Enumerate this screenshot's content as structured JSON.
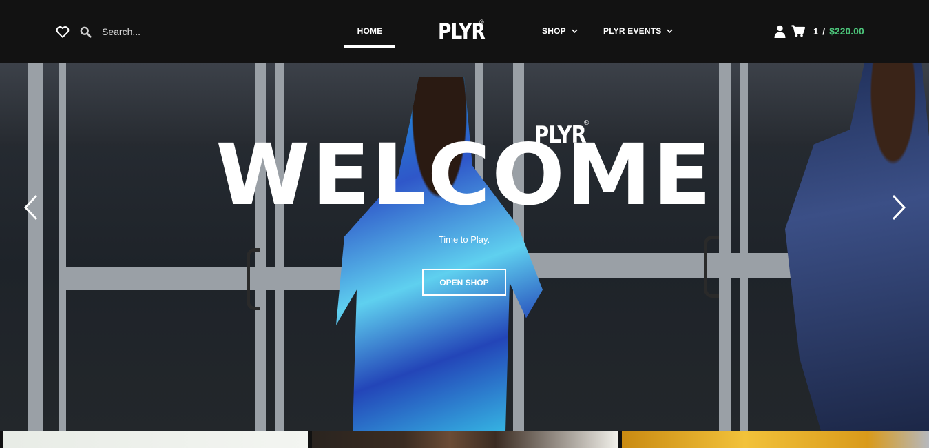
{
  "header": {
    "search_placeholder": "Search...",
    "logo_text": "PLYR",
    "logo_mark": "®",
    "nav": {
      "home": "HOME",
      "shop": "SHOP",
      "events": "PLYR EVENTS"
    },
    "cart": {
      "count": "1",
      "separator": "/",
      "total": "$220.00"
    },
    "icons": {
      "wishlist": "heart-icon",
      "search": "search-icon",
      "account": "user-icon",
      "cart": "cart-icon",
      "dropdown": "chevron-down-icon"
    },
    "colors": {
      "background": "#121212",
      "price": "#4cc47a"
    }
  },
  "hero": {
    "headline": "WELCOME",
    "logo_text": "PLYR",
    "logo_mark": "®",
    "tagline": "Time to Play.",
    "button_label": "OPEN SHOP",
    "prev_icon": "chevron-left-icon",
    "next_icon": "chevron-right-icon"
  }
}
